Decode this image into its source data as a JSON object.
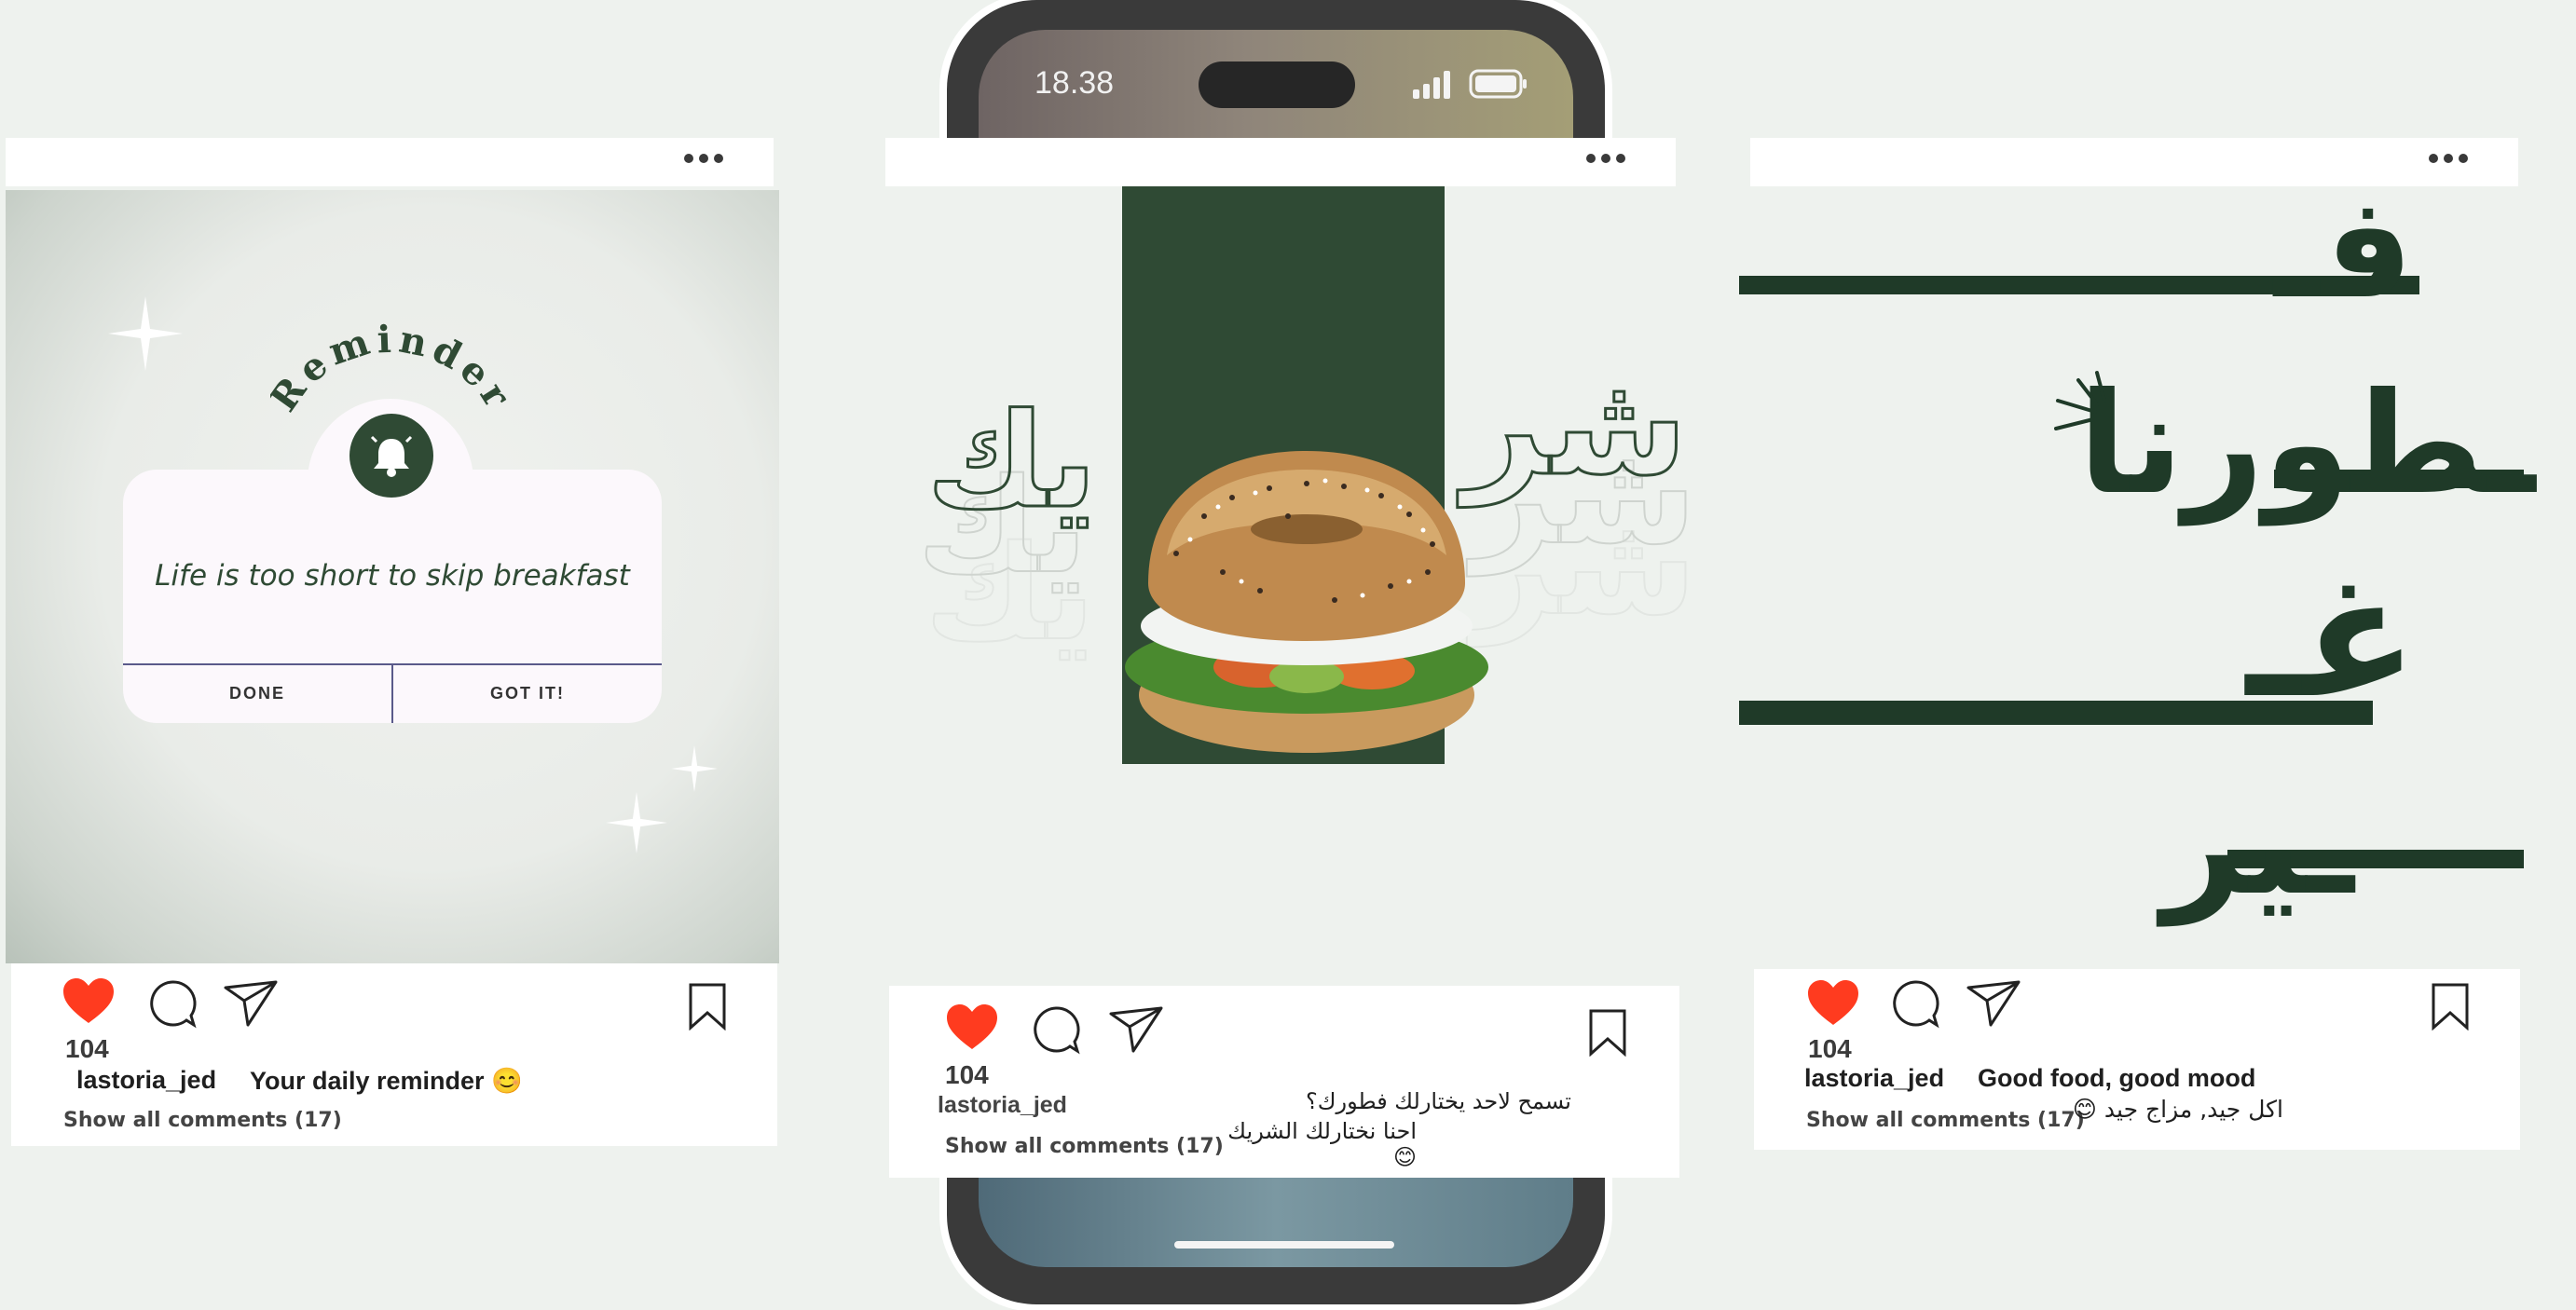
{
  "posts": [
    {
      "likes": "104",
      "username": "lastoria_jed",
      "caption": "Your daily reminder 😊",
      "comments": "Show all comments (17)",
      "reminder": {
        "title": "Reminder",
        "message": "Life is too short to skip breakfast",
        "done": "DONE",
        "got_it": "GOT IT!"
      }
    },
    {
      "likes": "104",
      "username": "lastoria_jed",
      "caption_line1": "تسمح لاحد يختارلك فطورك؟",
      "caption_line2": "احنا نختارلك الشريك😊",
      "comments": "Show all comments (17)",
      "art_word_right": "شر",
      "art_word_left": "يك"
    },
    {
      "likes": "104",
      "username": "lastoria_jed",
      "caption": "Good food, good mood",
      "caption_ar": "اكل جيد, مزاج جيد 😊",
      "comments": "Show all comments (17)",
      "art": [
        "فـ",
        "ـطورنا",
        "غـ",
        "ـير"
      ]
    }
  ],
  "phone": {
    "time": "18.38"
  },
  "colors": {
    "brand_green": "#2f4a34",
    "dark_green": "#1f3a28",
    "heart_red": "#ff3b1f",
    "card_bg": "#fcf8fc"
  }
}
